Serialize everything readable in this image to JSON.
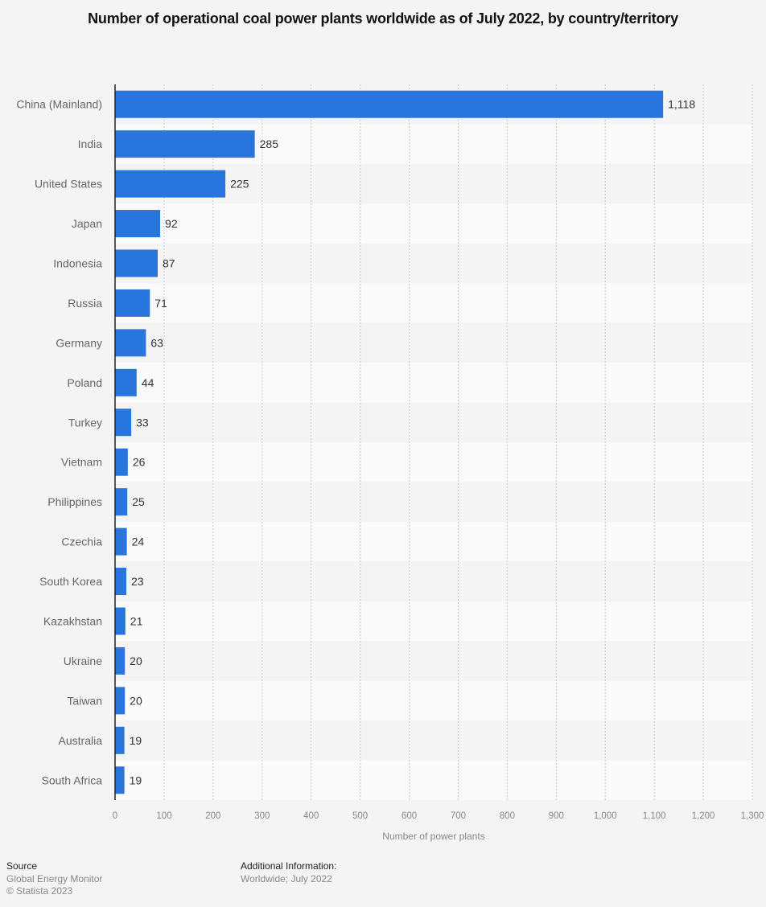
{
  "chart_data": {
    "type": "bar",
    "orientation": "horizontal",
    "title": "Number of operational coal power plants worldwide as of July 2022, by country/territory",
    "xlabel": "Number of power plants",
    "ylabel": "",
    "categories": [
      "China (Mainland)",
      "India",
      "United States",
      "Japan",
      "Indonesia",
      "Russia",
      "Germany",
      "Poland",
      "Turkey",
      "Vietnam",
      "Philippines",
      "Czechia",
      "South Korea",
      "Kazakhstan",
      "Ukraine",
      "Taiwan",
      "Australia",
      "South Africa"
    ],
    "values": [
      1118,
      285,
      225,
      92,
      87,
      71,
      63,
      44,
      33,
      26,
      25,
      24,
      23,
      21,
      20,
      20,
      19,
      19
    ],
    "value_labels": [
      "1,118",
      "285",
      "225",
      "92",
      "87",
      "71",
      "63",
      "44",
      "33",
      "26",
      "25",
      "24",
      "23",
      "21",
      "20",
      "20",
      "19",
      "19"
    ],
    "xlim": [
      0,
      1300
    ],
    "ticks": [
      0,
      100,
      200,
      300,
      400,
      500,
      600,
      700,
      800,
      900,
      1000,
      1100,
      1200,
      1300
    ],
    "tick_labels": [
      "0",
      "100",
      "200",
      "300",
      "400",
      "500",
      "600",
      "700",
      "800",
      "900",
      "1,000",
      "1,100",
      "1,200",
      "1,300"
    ],
    "grid": true,
    "legend": "none",
    "bar_color": "#2876dd"
  },
  "footer": {
    "source_heading": "Source",
    "source_lines": [
      "Global Energy Monitor",
      "© Statista 2023"
    ],
    "info_heading": "Additional Information:",
    "info_text": "Worldwide; July 2022"
  }
}
